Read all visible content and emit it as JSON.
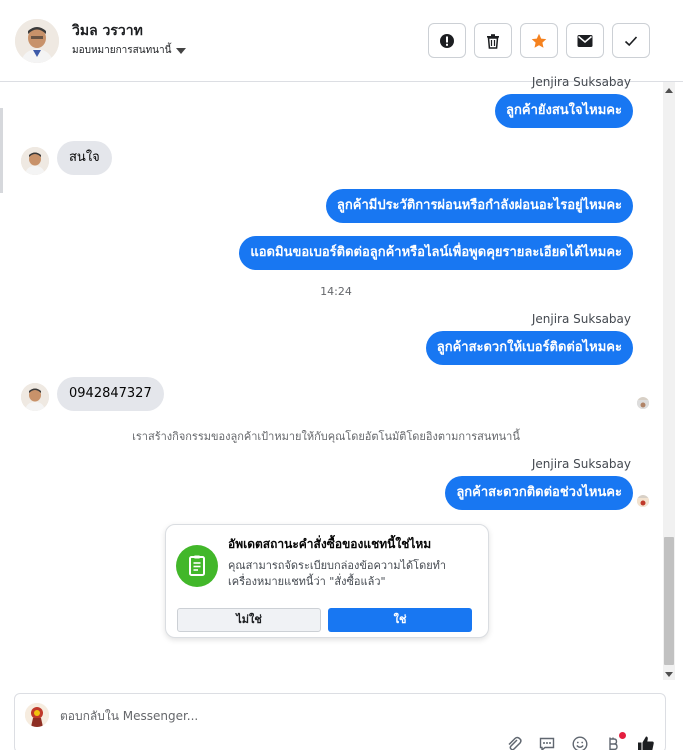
{
  "header": {
    "name": "วิมล วรวาท",
    "subtitle": "มอบหมายการสนทนานี้",
    "actions": [
      {
        "name": "alert-button",
        "icon": "alert-icon"
      },
      {
        "name": "delete-button",
        "icon": "trash-icon"
      },
      {
        "name": "star-button",
        "icon": "star-icon",
        "color": "#f5821f"
      },
      {
        "name": "mail-button",
        "icon": "mail-icon"
      },
      {
        "name": "done-button",
        "icon": "check-icon"
      }
    ]
  },
  "messages": {
    "m1_sender": "Jenjira Suksabay",
    "m1_text": "ลูกค้ายังสนใจไหมคะ",
    "m2_text": "สนใจ",
    "m3_text": "ลูกค้ามีประวัติการผ่อนหรือกำลังผ่อนอะไรอยู่ไหมคะ",
    "m4_text": "แอดมินขอเบอร์ติดต่อลูกค้าหรือไลน์เพื่อพูดคุยรายละเอียดได้ไหมคะ",
    "time": "14:24",
    "m5_sender": "Jenjira Suksabay",
    "m5_text": "ลูกค้าสะดวกให้เบอร์ติดต่อไหมคะ",
    "m6_text": "0942847327",
    "system_note": "เราสร้างกิจกรรมของลูกค้าเป้าหมายให้กับคุณโดยอัตโนมัติโดยอิงตามการสนทนานี้",
    "m7_sender": "Jenjira Suksabay",
    "m7_text": "ลูกค้าสะดวกติดต่อช่วงไหนคะ"
  },
  "order_card": {
    "title": "อัพเดตสถานะคำสั่งซื้อของแชทนี้ใช่ไหม",
    "body": "คุณสามารถจัดระเบียบกล่องข้อความได้โดยทำเครื่องหมายแชทนี้ว่า \"สั่งซื้อแล้ว\"",
    "no_label": "ไม่ใช่",
    "yes_label": "ใช่",
    "icon": "order-receipt-icon",
    "icon_color": "#42b72a"
  },
  "composer": {
    "placeholder": "ตอบกลับใน Messenger...",
    "tools": [
      "attach-icon",
      "saved-replies-icon",
      "emoji-icon",
      "currency-icon",
      "like-icon"
    ]
  },
  "colors": {
    "brand_blue": "#1877f2",
    "incoming_bg": "#e4e6eb"
  }
}
